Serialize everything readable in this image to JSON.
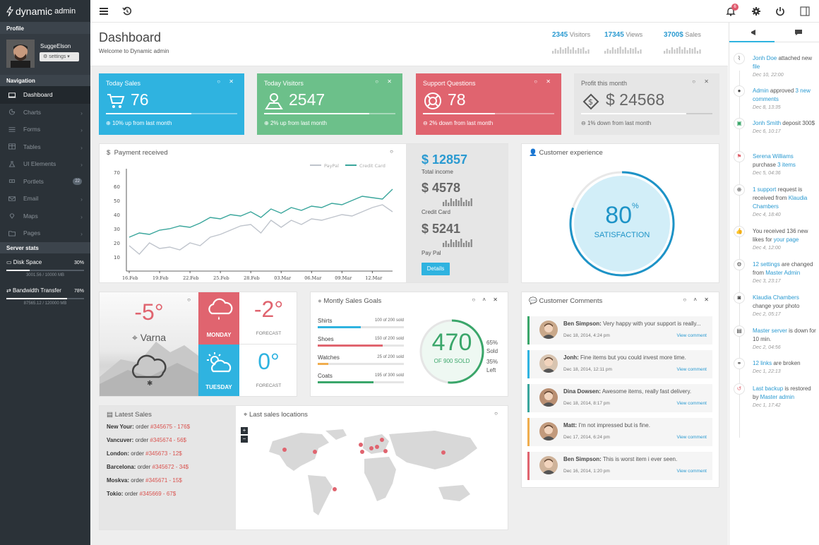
{
  "brand": {
    "logo": "dynamic",
    "sub": "admin"
  },
  "sidebar": {
    "profile_head": "Profile",
    "user_name": "SuggeElson",
    "settings_label": "settings",
    "nav_head": "Navigation",
    "items": [
      {
        "label": "Dashboard",
        "icon": "laptop-icon"
      },
      {
        "label": "Charts",
        "icon": "pie-chart-icon"
      },
      {
        "label": "Forms",
        "icon": "list-icon"
      },
      {
        "label": "Tables",
        "icon": "table-icon"
      },
      {
        "label": "UI Elements",
        "icon": "flask-icon"
      },
      {
        "label": "Portlets",
        "icon": "cubes-icon",
        "badge": "22"
      },
      {
        "label": "Email",
        "icon": "envelope-icon"
      },
      {
        "label": "Maps",
        "icon": "map-marker-icon"
      },
      {
        "label": "Pages",
        "icon": "folder-icon"
      }
    ],
    "server_head": "Server stats",
    "disk": {
      "label": "Disk Space",
      "pct": "30%",
      "sub": "3001.56 / 10000 MB",
      "fill": 0.3
    },
    "bandwidth": {
      "label": "Bandwidth Transfer",
      "pct": "78%",
      "sub": "87565.12 / 120000 MB",
      "fill": 0.78
    }
  },
  "topbar": {
    "notif_count": "6"
  },
  "header": {
    "title": "Dashboard",
    "subtitle": "Welcome to Dynamic admin",
    "stats": [
      {
        "value": "2345",
        "label": "Visitors"
      },
      {
        "value": "17345",
        "label": "Views"
      },
      {
        "value": "3700$",
        "label": "Sales"
      }
    ]
  },
  "tiles": [
    {
      "title": "Today Sales",
      "value": "76",
      "foot": "10% up from last month",
      "color": "#2fb3e0",
      "fill": 0.65
    },
    {
      "title": "Today Visitors",
      "value": "2547",
      "foot": "2% up from last month",
      "color": "#6cc08a",
      "fill": 0.8
    },
    {
      "title": "Support Questions",
      "value": "78",
      "foot": "2% down from last month",
      "color": "#e0646f",
      "fill": 0.55
    },
    {
      "title": "Profit this month",
      "value": "$ 24568",
      "foot": "1% down from last month",
      "color": "#e6e6e6",
      "fill": 0.8
    }
  ],
  "payment": {
    "title": "Payment received",
    "total": "$ 12857",
    "total_label": "Total income",
    "credit": "$ 4578",
    "credit_label": "Credit Card",
    "paypal": "$ 5241",
    "paypal_label": "Pay Pal",
    "details_button": "Details"
  },
  "chart_data": {
    "type": "line",
    "x": [
      "16.Feb",
      "17.Feb",
      "18.Feb",
      "19.Feb",
      "20.Feb",
      "21.Feb",
      "22.Feb",
      "23.Feb",
      "24.Feb",
      "25.Feb",
      "26.Feb",
      "27.Feb",
      "28.Feb",
      "1.Mar",
      "2.Mar",
      "3.Mar",
      "4.Mar",
      "5.Mar",
      "6.Mar",
      "7.Mar",
      "8.Mar",
      "9.Mar",
      "10.Mar",
      "11.Mar",
      "12.Mar",
      "13.Mar",
      "14.Mar"
    ],
    "tick_labels": [
      "16.Feb",
      "19.Feb",
      "22.Feb",
      "25.Feb",
      "28.Feb",
      "03.Mar",
      "06.Mar",
      "09.Mar",
      "12.Mar"
    ],
    "series": [
      {
        "name": "PayPal",
        "color": "#bfc4cc",
        "values": [
          18,
          12,
          20,
          16,
          17,
          15,
          20,
          18,
          24,
          26,
          29,
          32,
          33,
          27,
          36,
          31,
          36,
          33,
          37,
          36,
          38,
          40,
          39,
          42,
          45,
          47,
          42
        ]
      },
      {
        "name": "Credit Card",
        "color": "#3aa69c",
        "values": [
          24,
          27,
          26,
          29,
          30,
          32,
          31,
          34,
          38,
          37,
          40,
          39,
          42,
          38,
          44,
          41,
          45,
          43,
          46,
          45,
          48,
          47,
          50,
          53,
          52,
          51,
          58
        ]
      }
    ],
    "ylim": [
      0,
      70
    ],
    "yticks": [
      10,
      20,
      30,
      40,
      50,
      60,
      70
    ]
  },
  "experience": {
    "title": "Customer experience",
    "value": "80",
    "unit": "%",
    "label": "SATISFACTION",
    "fraction": 0.8
  },
  "weather": {
    "city": "Varna",
    "temp": "-5°",
    "days": [
      {
        "day": "MONDAY",
        "temp": "-2°",
        "label": "FORECAST",
        "color": "#e0646f"
      },
      {
        "day": "TUESDAY",
        "temp": "0°",
        "label": "FORECAST",
        "color": "#2fb3e0"
      }
    ]
  },
  "goals": {
    "title": "Montly Sales Goals",
    "items": [
      {
        "label": "Shirts",
        "sold": "100 of 200 sold",
        "fill": 0.5,
        "color": "#2fb3e0"
      },
      {
        "label": "Shoes",
        "sold": "150 of 200 sold",
        "fill": 0.75,
        "color": "#e0646f"
      },
      {
        "label": "Watches",
        "sold": "25 of 200 sold",
        "fill": 0.125,
        "color": "#f0ad4e"
      },
      {
        "label": "Coats",
        "sold": "195 of 300 sold",
        "fill": 0.65,
        "color": "#3aa66a"
      }
    ],
    "donut_value": "470",
    "donut_label": "OF 900 SOLD",
    "fraction": 0.52,
    "sold_pct": "65%",
    "sold_label": "Sold",
    "left_pct": "35%",
    "left_label": "Left"
  },
  "comments": {
    "title": "Customer Comments",
    "items": [
      {
        "name": "Ben Simpson:",
        "text": "Very happy with your support is really...",
        "date": "Dec 18, 2014, 4:24 pm",
        "link": "View comment",
        "color": "#3aa66a"
      },
      {
        "name": "Jonh:",
        "text": "Fine items but you could invest more time.",
        "date": "Dec 18, 2014, 12:11 pm",
        "link": "View comment",
        "color": "#2fb3e0"
      },
      {
        "name": "Dina Dowsen:",
        "text": "Awesome items, really fast delivery.",
        "date": "Dec 18, 2014, 8:17 pm",
        "link": "View comment",
        "color": "#3aa69c"
      },
      {
        "name": "Matt:",
        "text": "I'm not impressed but is fine.",
        "date": "Dec 17, 2014, 6:24 pm",
        "link": "View comment",
        "color": "#f0ad4e"
      },
      {
        "name": "Ben Simpson:",
        "text": "This is worst item i ever seen.",
        "date": "Dec 16, 2014, 1:20 pm",
        "link": "View comment",
        "color": "#e0646f"
      }
    ]
  },
  "latest_sales": {
    "title": "Latest Sales",
    "rows": [
      {
        "city": "New Your:",
        "order": "#345675",
        "amount": " - 176$"
      },
      {
        "city": "Vancuver:",
        "order": "#345674",
        "amount": " - 56$"
      },
      {
        "city": "London:",
        "order": "#345673",
        "amount": " - 12$"
      },
      {
        "city": "Barcelona:",
        "order": "#345672",
        "amount": " - 34$"
      },
      {
        "city": "Moskva:",
        "order": "#345671",
        "amount": " - 15$"
      },
      {
        "city": "Tokio:",
        "order": "#345669",
        "amount": " - 67$"
      }
    ],
    "order_prefix": "order "
  },
  "map": {
    "title": "Last sales locations",
    "zoom_in": "+",
    "zoom_out": "−"
  },
  "activity": [
    {
      "parts": [
        {
          "t": "Jonh Doe",
          "c": "blue"
        },
        {
          "t": " attached new "
        },
        {
          "t": "file",
          "c": "blue"
        }
      ],
      "time": "Dec 10, 22:00",
      "icon": "paperclip-icon"
    },
    {
      "parts": [
        {
          "t": "Admin",
          "c": "blue"
        },
        {
          "t": " approved "
        },
        {
          "t": "3 new comments",
          "c": "blue"
        }
      ],
      "time": "Dec 8, 13:35",
      "icon": "comment-icon"
    },
    {
      "parts": [
        {
          "t": "Jonh Smith",
          "c": "blue"
        },
        {
          "t": " deposit 300$"
        }
      ],
      "time": "Dec 6, 10:17",
      "icon": "money-icon"
    },
    {
      "parts": [
        {
          "t": "Serena Williams",
          "c": "blue"
        },
        {
          "t": " purchase "
        },
        {
          "t": "3 items",
          "c": "blue"
        }
      ],
      "time": "Dec 5, 04:36",
      "icon": "cart-icon"
    },
    {
      "parts": [
        {
          "t": "1 support",
          "c": "blue"
        },
        {
          "t": " request is received from "
        },
        {
          "t": "Klaudia Chambers",
          "c": "blue"
        }
      ],
      "time": "Dec 4, 18:40",
      "icon": "lifebuoy-icon"
    },
    {
      "parts": [
        {
          "t": "You received 136 new likes for "
        },
        {
          "t": "your page",
          "c": "blue"
        }
      ],
      "time": "Dec 4, 12:00",
      "icon": "thumbs-up-icon"
    },
    {
      "parts": [
        {
          "t": "12 settings",
          "c": "blue"
        },
        {
          "t": " are changed from "
        },
        {
          "t": "Master Admin",
          "c": "blue"
        }
      ],
      "time": "Dec 3, 23:17",
      "icon": "gear-icon"
    },
    {
      "parts": [
        {
          "t": "Klaudia Chambers",
          "c": "blue"
        },
        {
          "t": " change your photo"
        }
      ],
      "time": "Dec 2, 05:17",
      "icon": "camera-icon"
    },
    {
      "parts": [
        {
          "t": "Master server",
          "c": "blue"
        },
        {
          "t": " is down for 10 min."
        }
      ],
      "time": "Dec 2, 04:56",
      "icon": "server-icon"
    },
    {
      "parts": [
        {
          "t": "12 links",
          "c": "blue"
        },
        {
          "t": " are broken"
        }
      ],
      "time": "Dec 1, 22:13",
      "icon": "chain-broken-icon"
    },
    {
      "parts": [
        {
          "t": "Last backup",
          "c": "blue"
        },
        {
          "t": " is restored by "
        },
        {
          "t": "Master admin",
          "c": "blue"
        }
      ],
      "time": "Dec 1, 17:42",
      "icon": "restore-icon"
    }
  ]
}
